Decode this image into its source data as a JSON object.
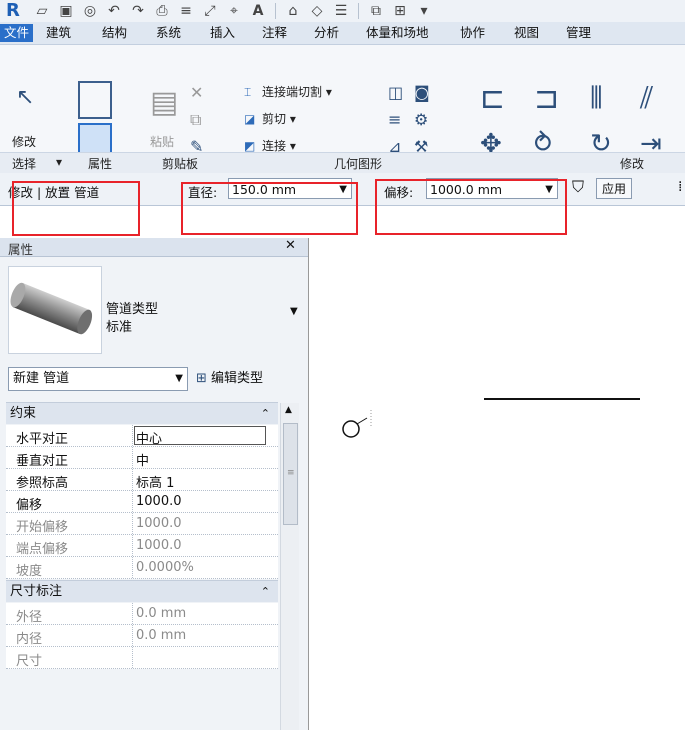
{
  "titlebar": {
    "logo": "R",
    "quick_access": [
      "open-icon",
      "save-icon",
      "sync-icon",
      "undo-icon",
      "redo-icon",
      "print-icon",
      "measure-icon",
      "dimension-icon",
      "tag-icon",
      "text-icon",
      "view-3d-icon",
      "section-icon",
      "thin-lines-icon",
      "close-views-icon",
      "switch-windows-icon"
    ]
  },
  "tabs": [
    "文件",
    "建筑",
    "结构",
    "系统",
    "插入",
    "注释",
    "分析",
    "体量和场地",
    "协作",
    "视图",
    "管理"
  ],
  "ribbon": {
    "modify_label": "修改",
    "paste_label": "粘贴",
    "cope_label": "连接端切割",
    "cut_label": "剪切",
    "join_label": "连接",
    "panels": [
      "选择",
      "属性",
      "剪贴板",
      "几何图形",
      "修改"
    ]
  },
  "optbar": {
    "context": "修改 | 放置 管道",
    "diameter_label": "直径:",
    "diameter_value": "150.0 mm",
    "offset_label": "偏移:",
    "offset_value": "1000.0 mm",
    "apply_label": "应用"
  },
  "props": {
    "title": "属性",
    "type_family": "管道类型",
    "type_name": "标准",
    "instance_select": "新建 管道",
    "edit_type": "编辑类型",
    "groups": [
      {
        "name": "约束",
        "rows": [
          {
            "k": "水平对正",
            "v": "中心"
          },
          {
            "k": "垂直对正",
            "v": "中"
          },
          {
            "k": "参照标高",
            "v": "标高 1"
          },
          {
            "k": "偏移",
            "v": "1000.0"
          },
          {
            "k": "开始偏移",
            "v": "1000.0"
          },
          {
            "k": "端点偏移",
            "v": "1000.0"
          },
          {
            "k": "坡度",
            "v": "0.0000%"
          }
        ]
      },
      {
        "name": "尺寸标注",
        "rows": [
          {
            "k": "外径",
            "v": "0.0 mm"
          },
          {
            "k": "内径",
            "v": "0.0 mm"
          },
          {
            "k": "尺寸",
            "v": ""
          }
        ]
      }
    ]
  },
  "colors": {
    "highlight": "#e8232a",
    "accent": "#2a6fc9"
  }
}
